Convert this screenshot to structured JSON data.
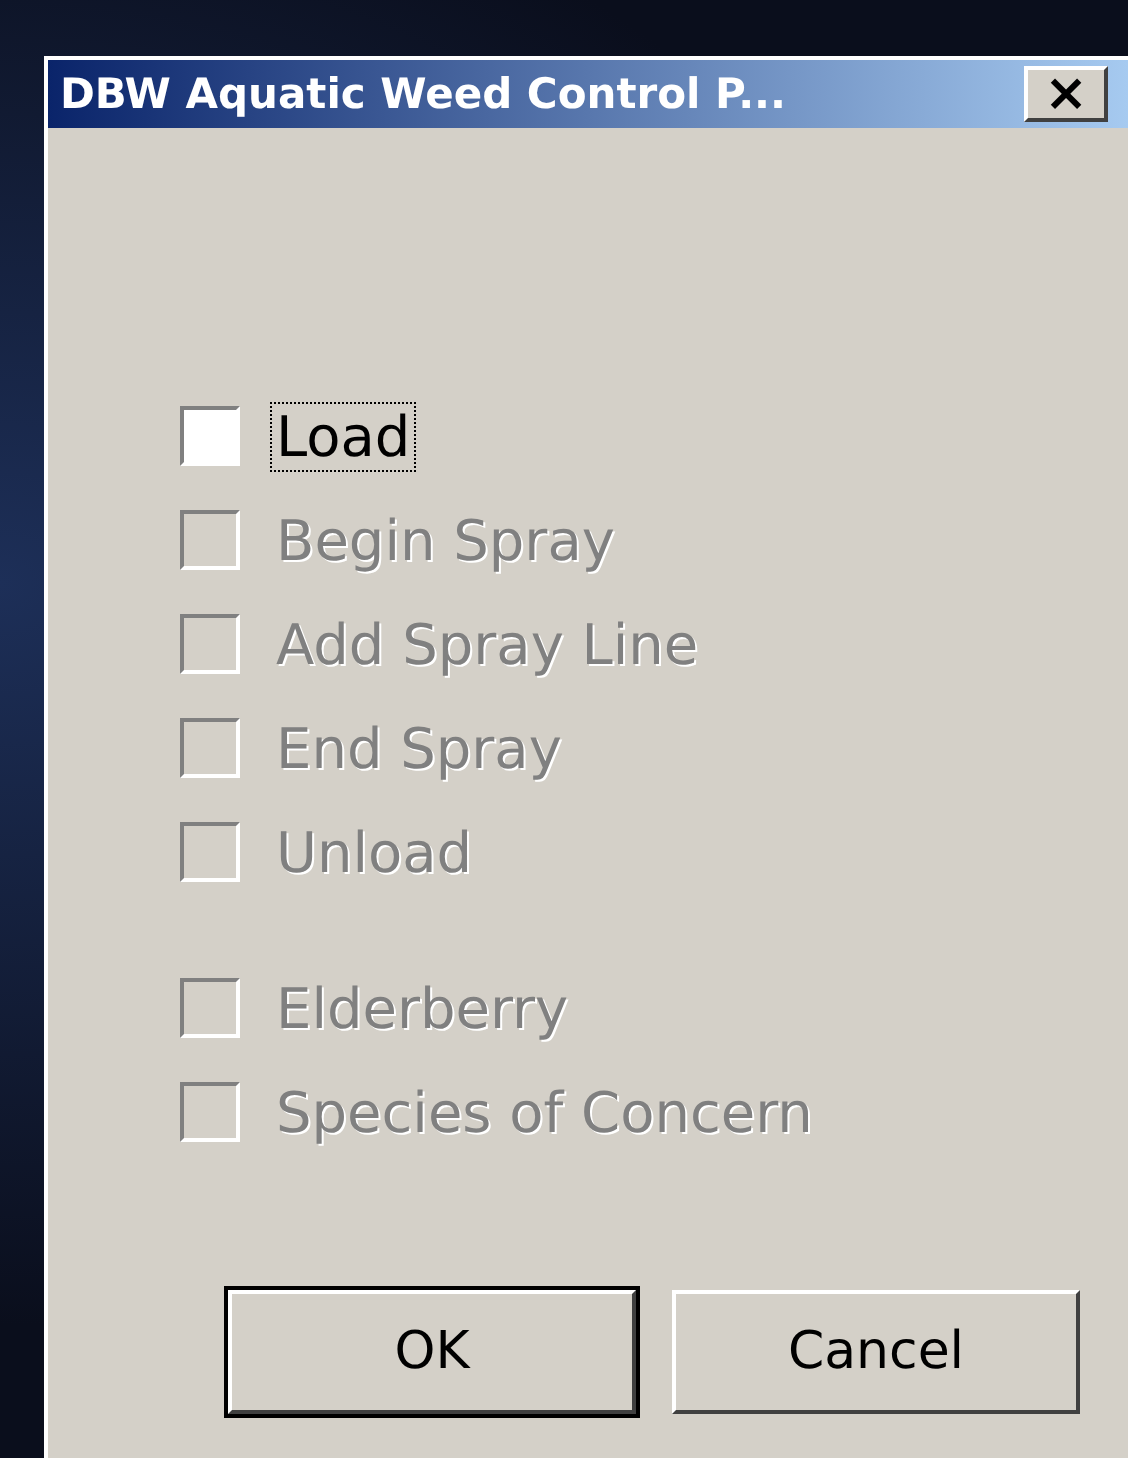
{
  "window": {
    "title": "DBW Aquatic Weed Control P...",
    "close": "×"
  },
  "checkbox_groups": [
    [
      {
        "label": "Load",
        "checked": false,
        "disabled": false,
        "focused": true
      },
      {
        "label": "Begin Spray",
        "checked": false,
        "disabled": true,
        "focused": false
      },
      {
        "label": "Add Spray Line",
        "checked": false,
        "disabled": true,
        "focused": false
      },
      {
        "label": "End Spray",
        "checked": false,
        "disabled": true,
        "focused": false
      },
      {
        "label": "Unload",
        "checked": false,
        "disabled": true,
        "focused": false
      }
    ],
    [
      {
        "label": "Elderberry",
        "checked": false,
        "disabled": true,
        "focused": false
      },
      {
        "label": "Species of Concern",
        "checked": false,
        "disabled": true,
        "focused": false
      }
    ]
  ],
  "buttons": [
    {
      "label": "OK",
      "default": true
    },
    {
      "label": "Cancel",
      "default": false
    }
  ]
}
